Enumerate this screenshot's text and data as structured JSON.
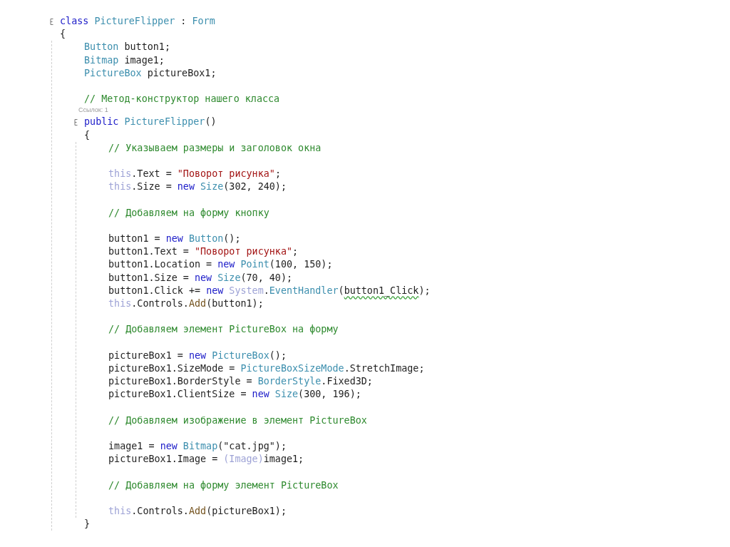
{
  "editor": {
    "lines": [
      {
        "kind": "line",
        "foldable": true,
        "tokens": [
          {
            "text": "class",
            "kind": "keyword"
          },
          {
            "text": " PictureFlipper",
            "kind": "type"
          },
          {
            "text": " : ",
            "kind": "plain"
          },
          {
            "text": "Form",
            "kind": "type"
          }
        ]
      },
      {
        "kind": "line",
        "foldable": false,
        "tokens": [
          {
            "text": "{",
            "kind": "plain"
          }
        ]
      },
      {
        "kind": "block",
        "children": [
          {
            "kind": "line",
            "foldable": false,
            "tokens": [
              {
                "text": "Button",
                "kind": "type"
              },
              {
                "text": " button1;",
                "kind": "plain"
              }
            ]
          },
          {
            "kind": "line",
            "foldable": false,
            "tokens": [
              {
                "text": "Bitmap",
                "kind": "type"
              },
              {
                "text": " image1;",
                "kind": "plain"
              }
            ]
          },
          {
            "kind": "line",
            "foldable": false,
            "tokens": [
              {
                "text": "PictureBox",
                "kind": "type"
              },
              {
                "text": " pictureBox1;",
                "kind": "plain"
              }
            ]
          },
          {
            "kind": "blank"
          },
          {
            "kind": "line",
            "foldable": false,
            "tokens": [
              {
                "text": "// Метод-конструктор нашего класса",
                "kind": "comment"
              }
            ]
          },
          {
            "kind": "codelens",
            "text": "Ссылок: 1"
          },
          {
            "kind": "line",
            "foldable": true,
            "tokens": [
              {
                "text": "public",
                "kind": "keyword"
              },
              {
                "text": " PictureFlipper",
                "kind": "type"
              },
              {
                "text": "()",
                "kind": "plain"
              }
            ]
          },
          {
            "kind": "line",
            "foldable": false,
            "tokens": [
              {
                "text": "{",
                "kind": "plain"
              }
            ]
          },
          {
            "kind": "block",
            "children": [
              {
                "kind": "line",
                "foldable": false,
                "tokens": [
                  {
                    "text": "// Указываем размеры и заголовок окна",
                    "kind": "comment"
                  }
                ]
              },
              {
                "kind": "blank"
              },
              {
                "kind": "line",
                "foldable": false,
                "tokens": [
                  {
                    "text": "this",
                    "kind": "faded"
                  },
                  {
                    "text": ".Text = ",
                    "kind": "plain"
                  },
                  {
                    "text": "\"Поворот рисунка\"",
                    "kind": "string"
                  },
                  {
                    "text": ";",
                    "kind": "plain"
                  }
                ]
              },
              {
                "kind": "line",
                "foldable": false,
                "tokens": [
                  {
                    "text": "this",
                    "kind": "faded"
                  },
                  {
                    "text": ".Size = ",
                    "kind": "plain"
                  },
                  {
                    "text": "new",
                    "kind": "keyword"
                  },
                  {
                    "text": " Size",
                    "kind": "type"
                  },
                  {
                    "text": "(302, 240);",
                    "kind": "plain"
                  }
                ]
              },
              {
                "kind": "blank"
              },
              {
                "kind": "line",
                "foldable": false,
                "tokens": [
                  {
                    "text": "// Добавляем на форму кнопку",
                    "kind": "comment"
                  }
                ]
              },
              {
                "kind": "blank"
              },
              {
                "kind": "line",
                "foldable": false,
                "tokens": [
                  {
                    "text": "button1 = ",
                    "kind": "plain"
                  },
                  {
                    "text": "new",
                    "kind": "keyword"
                  },
                  {
                    "text": " Button",
                    "kind": "type"
                  },
                  {
                    "text": "();",
                    "kind": "plain"
                  }
                ]
              },
              {
                "kind": "line",
                "foldable": false,
                "tokens": [
                  {
                    "text": "button1.Text = ",
                    "kind": "plain"
                  },
                  {
                    "text": "\"Поворот рисунка\"",
                    "kind": "string"
                  },
                  {
                    "text": ";",
                    "kind": "plain"
                  }
                ]
              },
              {
                "kind": "line",
                "foldable": false,
                "tokens": [
                  {
                    "text": "button1.Location = ",
                    "kind": "plain"
                  },
                  {
                    "text": "new",
                    "kind": "keyword"
                  },
                  {
                    "text": " Point",
                    "kind": "type"
                  },
                  {
                    "text": "(100, 150);",
                    "kind": "plain"
                  }
                ]
              },
              {
                "kind": "line",
                "foldable": false,
                "tokens": [
                  {
                    "text": "button1.Size = ",
                    "kind": "plain"
                  },
                  {
                    "text": "new",
                    "kind": "keyword"
                  },
                  {
                    "text": " Size",
                    "kind": "type"
                  },
                  {
                    "text": "(70, 40);",
                    "kind": "plain"
                  }
                ]
              },
              {
                "kind": "line",
                "foldable": false,
                "tokens": [
                  {
                    "text": "button1.Click += ",
                    "kind": "plain"
                  },
                  {
                    "text": "new",
                    "kind": "keyword"
                  },
                  {
                    "text": " System",
                    "kind": "faded"
                  },
                  {
                    "text": ".",
                    "kind": "plain"
                  },
                  {
                    "text": "EventHandler",
                    "kind": "type"
                  },
                  {
                    "text": "(",
                    "kind": "plain"
                  },
                  {
                    "text": "button1_Click",
                    "kind": "warning"
                  },
                  {
                    "text": ");",
                    "kind": "plain"
                  }
                ]
              },
              {
                "kind": "line",
                "foldable": false,
                "tokens": [
                  {
                    "text": "this",
                    "kind": "faded"
                  },
                  {
                    "text": ".Controls.",
                    "kind": "plain"
                  },
                  {
                    "text": "Add",
                    "kind": "method"
                  },
                  {
                    "text": "(button1);",
                    "kind": "plain"
                  }
                ]
              },
              {
                "kind": "blank"
              },
              {
                "kind": "line",
                "foldable": false,
                "tokens": [
                  {
                    "text": "// Добавляем элемент PictureBox на форму",
                    "kind": "comment"
                  }
                ]
              },
              {
                "kind": "blank"
              },
              {
                "kind": "line",
                "foldable": false,
                "tokens": [
                  {
                    "text": "pictureBox1 = ",
                    "kind": "plain"
                  },
                  {
                    "text": "new",
                    "kind": "keyword"
                  },
                  {
                    "text": " PictureBox",
                    "kind": "type"
                  },
                  {
                    "text": "();",
                    "kind": "plain"
                  }
                ]
              },
              {
                "kind": "line",
                "foldable": false,
                "tokens": [
                  {
                    "text": "pictureBox1.SizeMode = ",
                    "kind": "plain"
                  },
                  {
                    "text": "PictureBoxSizeMode",
                    "kind": "type"
                  },
                  {
                    "text": ".StretchImage;",
                    "kind": "plain"
                  }
                ]
              },
              {
                "kind": "line",
                "foldable": false,
                "tokens": [
                  {
                    "text": "pictureBox1.BorderStyle = ",
                    "kind": "plain"
                  },
                  {
                    "text": "BorderStyle",
                    "kind": "type"
                  },
                  {
                    "text": ".Fixed3D;",
                    "kind": "plain"
                  }
                ]
              },
              {
                "kind": "line",
                "foldable": false,
                "tokens": [
                  {
                    "text": "pictureBox1.ClientSize = ",
                    "kind": "plain"
                  },
                  {
                    "text": "new",
                    "kind": "keyword"
                  },
                  {
                    "text": " Size",
                    "kind": "type"
                  },
                  {
                    "text": "(300, 196);",
                    "kind": "plain"
                  }
                ]
              },
              {
                "kind": "blank"
              },
              {
                "kind": "line",
                "foldable": false,
                "tokens": [
                  {
                    "text": "// Добавляем изображение в элемент PictureBox",
                    "kind": "comment"
                  }
                ]
              },
              {
                "kind": "blank"
              },
              {
                "kind": "line",
                "foldable": false,
                "tokens": [
                  {
                    "text": "image1 = ",
                    "kind": "plain"
                  },
                  {
                    "text": "new",
                    "kind": "keyword"
                  },
                  {
                    "text": " Bitmap",
                    "kind": "type"
                  },
                  {
                    "text": "(\"cat.jpg\");",
                    "kind": "plain"
                  }
                ]
              },
              {
                "kind": "line",
                "foldable": false,
                "tokens": [
                  {
                    "text": "pictureBox1.Image = ",
                    "kind": "plain"
                  },
                  {
                    "text": "(Image)",
                    "kind": "faded"
                  },
                  {
                    "text": "image1;",
                    "kind": "plain"
                  }
                ]
              },
              {
                "kind": "blank"
              },
              {
                "kind": "line",
                "foldable": false,
                "tokens": [
                  {
                    "text": "// Добавляем на форму элемент PictureBox",
                    "kind": "comment"
                  }
                ]
              },
              {
                "kind": "blank"
              },
              {
                "kind": "line",
                "foldable": false,
                "tokens": [
                  {
                    "text": "this",
                    "kind": "faded"
                  },
                  {
                    "text": ".Controls.",
                    "kind": "plain"
                  },
                  {
                    "text": "Add",
                    "kind": "method"
                  },
                  {
                    "text": "(pictureBox1);",
                    "kind": "plain"
                  }
                ]
              }
            ]
          },
          {
            "kind": "line",
            "foldable": false,
            "tokens": [
              {
                "text": "}",
                "kind": "plain"
              }
            ]
          }
        ]
      }
    ]
  }
}
